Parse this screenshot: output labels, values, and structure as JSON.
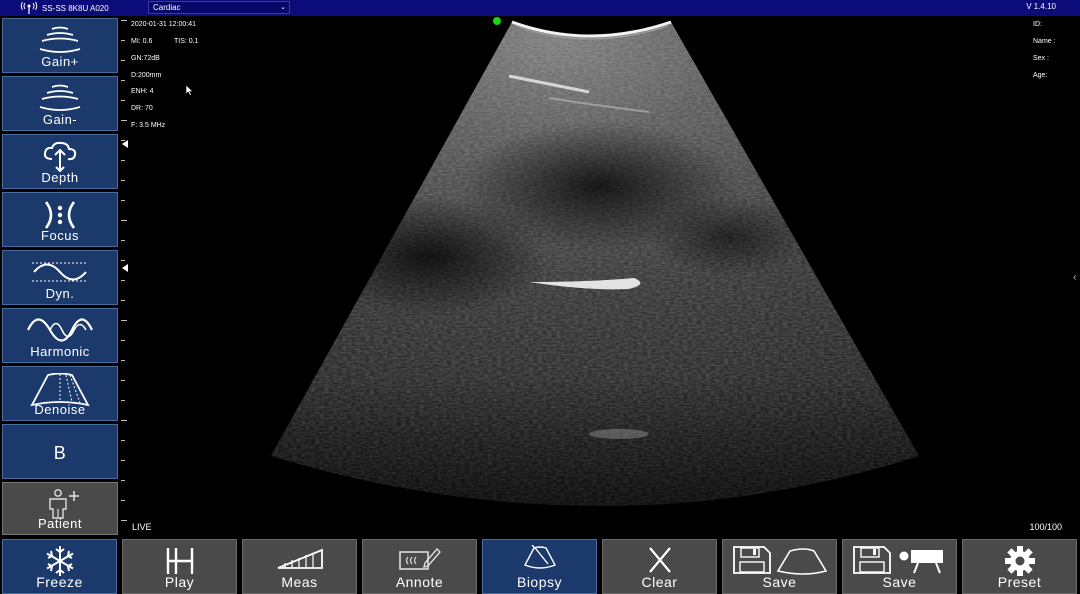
{
  "topbar": {
    "device": "SS-SS 8K8U A020",
    "preset": "Cardiac",
    "version": "V 1.4.10"
  },
  "left_buttons": {
    "gain_plus": "Gain+",
    "gain_minus": "Gain-",
    "depth": "Depth",
    "focus": "Focus",
    "dyn": "Dyn.",
    "harmonic": "Harmonic",
    "denoise": "Denoise",
    "mode": "B",
    "patient": "Patient"
  },
  "image_info": {
    "datetime": "2020-01-31 12:00:41",
    "mi": "MI:  0.6",
    "tis": "TIS:  0.1",
    "gain": "GN:72dB",
    "depth": "D:200mm",
    "enh": "ENH: 4",
    "dr": "DR: 70",
    "freq": "F: 3.5 MHz"
  },
  "patient_info": {
    "id": "ID:",
    "name": "Name :",
    "sex": "Sex :",
    "age": "Age:"
  },
  "status": {
    "live": "LIVE",
    "frames": "100/100"
  },
  "bottom_buttons": {
    "freeze": "Freeze",
    "play": "Play",
    "meas": "Meas",
    "annote": "Annote",
    "biopsy": "Biopsy",
    "clear": "Clear",
    "save_image": "Save",
    "save_video": "Save",
    "preset": "Preset"
  },
  "colors": {
    "topbar": "#0b0b7a",
    "button_blue": "#1b3a6b",
    "button_gray": "#4a4a4a",
    "indicator": "#19d419"
  },
  "icons": {
    "gain_plus": "gain-plus-icon",
    "gain_minus": "gain-minus-icon",
    "depth": "depth-icon",
    "focus": "focus-icon",
    "dyn": "dynamic-range-icon",
    "harmonic": "harmonic-wave-icon",
    "denoise": "denoise-icon",
    "patient": "patient-icon",
    "freeze": "snowflake-icon",
    "play": "play-cine-icon",
    "meas": "measure-icon",
    "annote": "annotate-icon",
    "biopsy": "biopsy-icon",
    "clear": "clear-x-icon",
    "save_image": "save-image-icon",
    "save_video": "save-video-icon",
    "preset": "gear-icon"
  }
}
